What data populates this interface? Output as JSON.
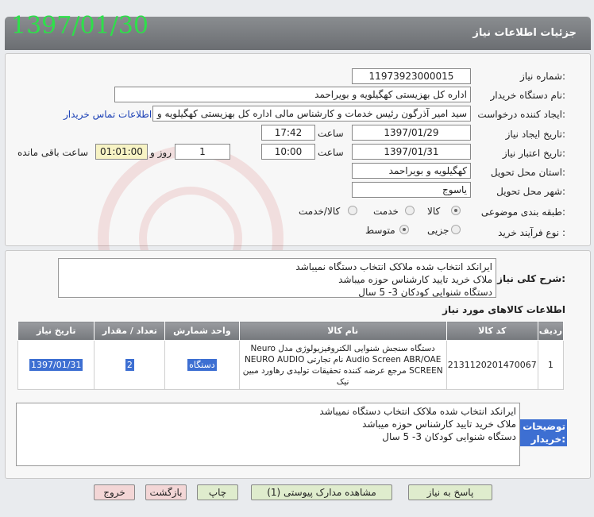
{
  "header": {
    "title": "جزئیات اطلاعات نیاز",
    "date": "1397/01/30"
  },
  "form": {
    "need_number_label": "شماره نیاز:",
    "need_number": "1197392300001​5",
    "buyer_label": "نام دستگاه خریدار:",
    "buyer": "اداره کل بهزیستی کهگیلویه و بویراحمد",
    "requester_label": "ایجاد کننده درخواست:",
    "requester": "سید امیر آذرگون رئیس خدمات و کارشناس مالی اداره کل بهزیستی کهگیلویه و",
    "contact_link": "اطلاعات تماس خریدار",
    "created_label": "تاریخ ایجاد نیاز:",
    "created_date": "1397/01/29",
    "time_label": "ساعت",
    "created_time": "17:42",
    "valid_label": "تاریخ اعتبار نیاز:",
    "valid_date": "1397/01/31",
    "valid_time": "10:00",
    "days_value": "1",
    "days_label": "روز و",
    "remaining_time": "01:01:00",
    "remaining_label": "ساعت باقی مانده",
    "province_label": "استان محل تحویل:",
    "province": "کهگیلویه و بویراحمد",
    "city_label": "شهر محل تحویل:",
    "city": "یاسوج",
    "category_label": "طبقه بندی موضوعی:",
    "category_options": [
      "کالا",
      "خدمت",
      "کالا/خدمت"
    ],
    "category_selected": "کالا",
    "process_label": "نوع فرآیند خرید :",
    "process_options": [
      "جزیی",
      "متوسط"
    ],
    "process_selected": "متوسط"
  },
  "description": {
    "label": "شرح کلی نیاز:",
    "lines": [
      "ایرانکد انتخاب شده ملاکک انتخاب دستگاه نمیباشد",
      "ملاک خرید تایید کارشناس حوزه میباشد",
      "دستگاه شنوایی کودکان 3- 5 سال"
    ]
  },
  "items": {
    "title": "اطلاعات کالاهای مورد نیاز",
    "columns": [
      "ردیف",
      "کد کالا",
      "نام کالا",
      "واحد شمارش",
      "تعداد / مقدار",
      "تاریخ نیاز"
    ],
    "rows": [
      {
        "row": "1",
        "code": "2131120201470067",
        "name": "دستگاه سنجش شنوایی الکتروفیزیولوژی مدل Neuro Audio Screen ABR/OAE نام تجارتی NEURO AUDIO SCREEN مرجع عرضه کننده تحقیقات تولیدی رهاورد مبین نیک",
        "unit": "دستگاه",
        "qty": "2",
        "date": "1397/01/31"
      }
    ]
  },
  "buyer_notes": {
    "label": "توضیحات خریدار:",
    "lines": [
      "ایرانکد انتخاب شده ملاکک انتخاب دستگاه نمیباشد",
      "ملاک خرید تایید کارشناس حوزه میباشد",
      "دستگاه شنوایی کودکان 3- 5 سال"
    ]
  },
  "buttons": {
    "reply": "پاسخ به نیاز",
    "attachments": "مشاهده مدارک پیوستی (1)",
    "print": "چاپ",
    "back": "بازگشت",
    "exit": "خروج"
  },
  "colors": {
    "header_bg": "#7a7d81",
    "date_green": "#2ee04a",
    "button_green": "#dfeccd",
    "button_pink": "#f3d6d6",
    "highlight": "#3d6fd2"
  }
}
